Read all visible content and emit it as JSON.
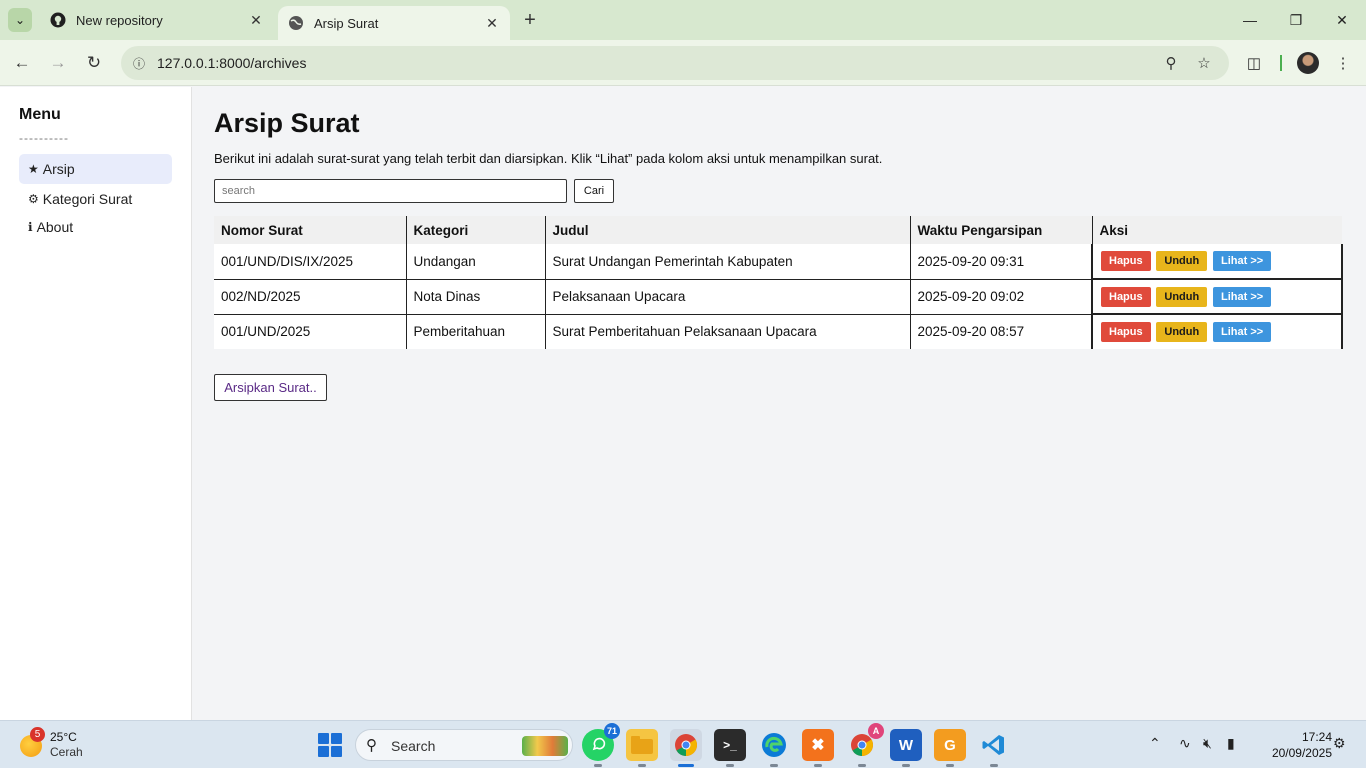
{
  "browser": {
    "tabs": [
      {
        "title": "New repository",
        "icon": "github-icon"
      },
      {
        "title": "Arsip Surat",
        "icon": "globe-icon"
      }
    ],
    "url": "127.0.0.1:8000/archives"
  },
  "sidebar": {
    "title": "Menu",
    "divider": "----------",
    "items": [
      {
        "icon": "★",
        "label": "Arsip"
      },
      {
        "icon": "⚙",
        "label": "Kategori Surat"
      },
      {
        "icon": "ℹ",
        "label": "About"
      }
    ]
  },
  "main": {
    "title": "Arsip Surat",
    "description": "Berikut ini adalah surat-surat yang telah terbit dan diarsipkan. Klik “Lihat” pada kolom aksi untuk menampilkan surat.",
    "search_placeholder": "search",
    "search_button": "Cari",
    "columns": [
      "Nomor Surat",
      "Kategori",
      "Judul",
      "Waktu Pengarsipan",
      "Aksi"
    ],
    "rows": [
      {
        "nomor": "001/UND/DIS/IX/2025",
        "kategori": "Undangan",
        "judul": "Surat Undangan Pemerintah Kabupaten",
        "waktu": "2025-09-20 09:31"
      },
      {
        "nomor": "002/ND/2025",
        "kategori": "Nota Dinas",
        "judul": "Pelaksanaan Upacara",
        "waktu": "2025-09-20 09:02"
      },
      {
        "nomor": "001/UND/2025",
        "kategori": "Pemberitahuan",
        "judul": "Surat Pemberitahuan Pelaksanaan Upacara",
        "waktu": "2025-09-20 08:57"
      }
    ],
    "actions": {
      "delete": "Hapus",
      "download": "Unduh",
      "view": "Lihat >>"
    },
    "archive_button": "Arsipkan Surat.."
  },
  "taskbar": {
    "weather_badge": "5",
    "temperature": "25°C",
    "condition": "Cerah",
    "search_label": "Search",
    "whatsapp_badge": "71",
    "chrome_profile_badge": "A",
    "time": "17:24",
    "date": "20/09/2025"
  },
  "colors": {
    "delete": "#e04a3b",
    "download": "#e8b51b",
    "view": "#3d95de",
    "active_menu": "#e8ecfb"
  }
}
